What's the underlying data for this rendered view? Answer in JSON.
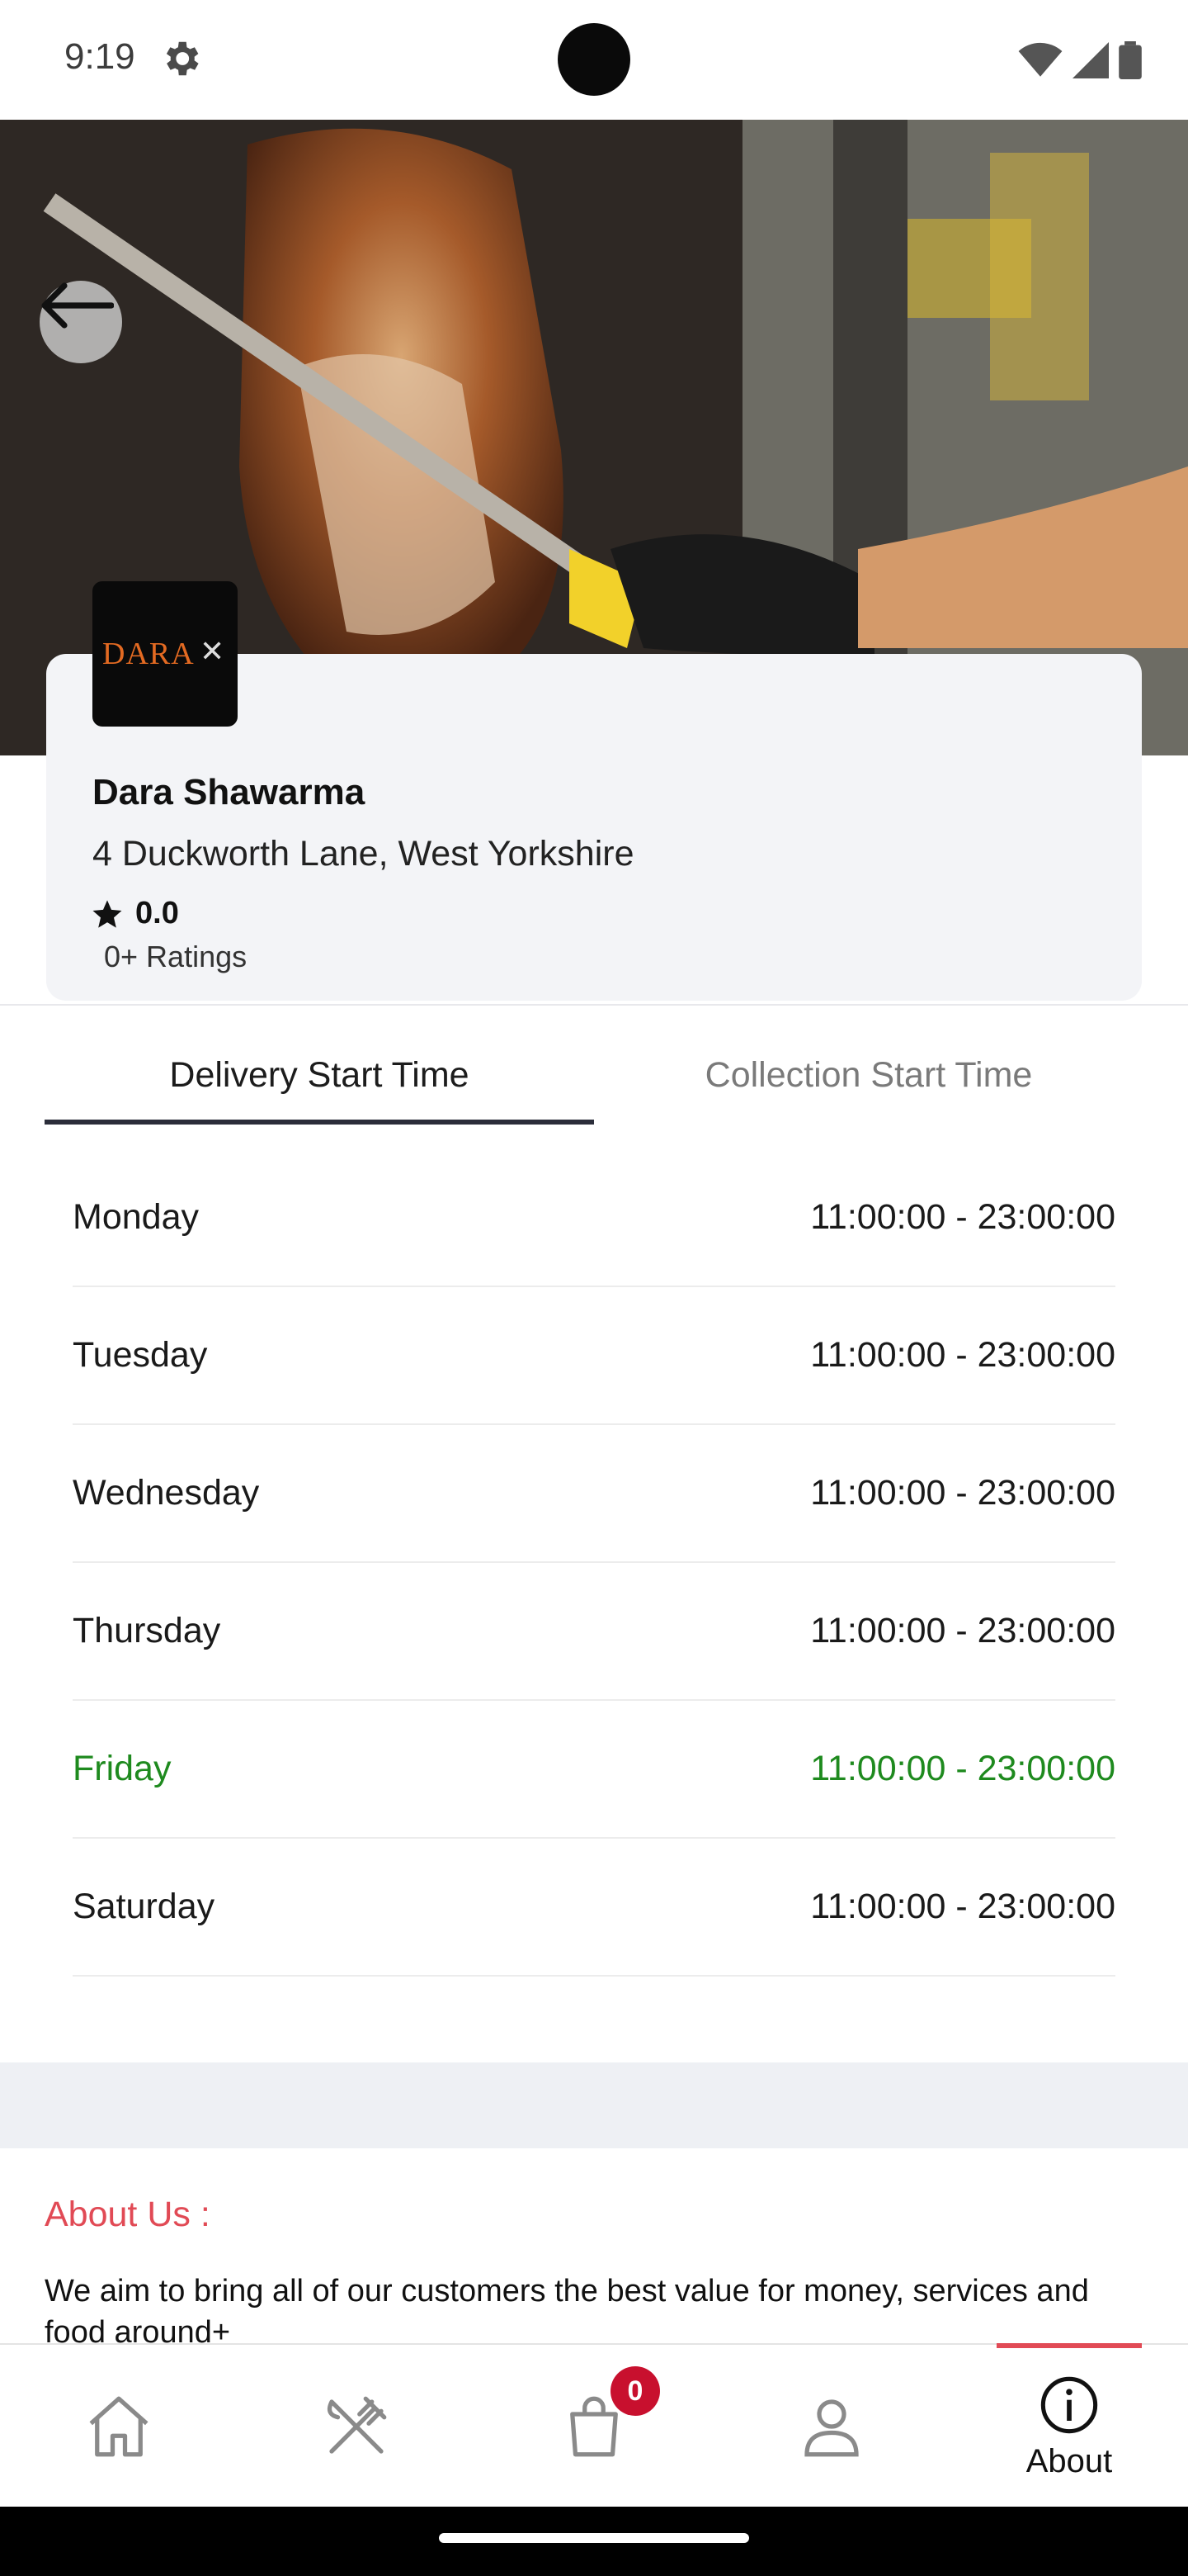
{
  "status_bar": {
    "time": "9:19"
  },
  "restaurant": {
    "logo_text": "DARA",
    "name": "Dara Shawarma",
    "address": "4 Duckworth Lane, West Yorkshire",
    "rating": "0.0",
    "rating_count": "0+ Ratings"
  },
  "tabs": [
    {
      "label": "Delivery Start Time",
      "active": true
    },
    {
      "label": "Collection Start Time",
      "active": false
    }
  ],
  "schedule": [
    {
      "day": "Monday",
      "hours": "11:00:00 - 23:00:00"
    },
    {
      "day": "Tuesday",
      "hours": "11:00:00 - 23:00:00"
    },
    {
      "day": "Wednesday",
      "hours": "11:00:00 - 23:00:00"
    },
    {
      "day": "Thursday",
      "hours": "11:00:00 - 23:00:00"
    },
    {
      "day": "Friday",
      "hours": "11:00:00 - 23:00:00",
      "highlight": true
    },
    {
      "day": "Saturday",
      "hours": "11:00:00 - 23:00:00"
    }
  ],
  "about": {
    "title": "About Us :",
    "text": "We aim to bring all of our customers the best value for money, services and food around+"
  },
  "bottom_nav": {
    "items": [
      {
        "icon": "home-icon"
      },
      {
        "icon": "utensils-icon"
      },
      {
        "icon": "shopping-bag-icon",
        "badge": "0"
      },
      {
        "icon": "user-icon"
      },
      {
        "icon": "info-icon",
        "label": "About",
        "active": true
      }
    ]
  },
  "colors": {
    "accent_red": "#e14a55",
    "today_green": "#1e8a1e",
    "badge_red": "#c8102e",
    "tab_indicator": "#2b2d3a"
  }
}
